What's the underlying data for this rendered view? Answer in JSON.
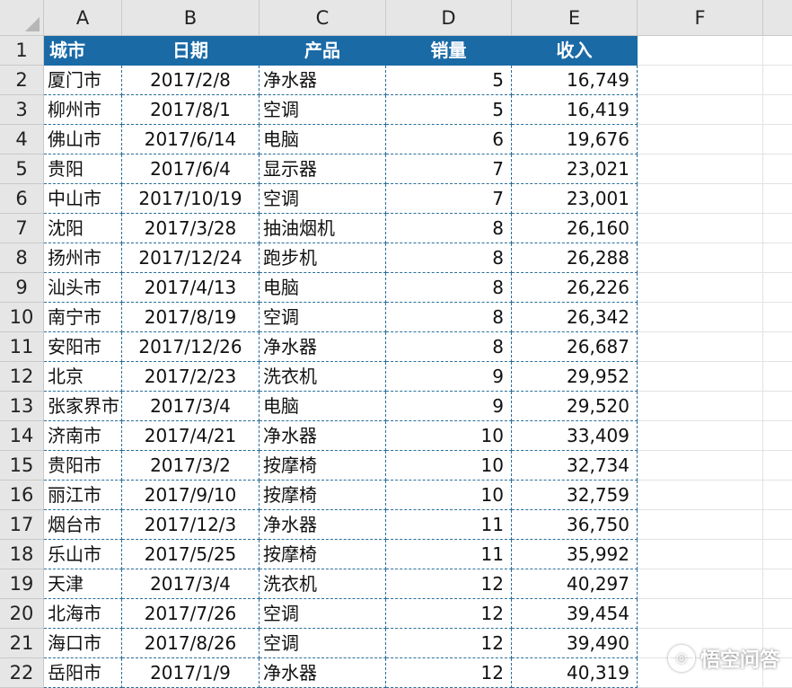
{
  "columns": [
    "A",
    "B",
    "C",
    "D",
    "E",
    "F"
  ],
  "header_row": {
    "row_num": "1",
    "city": "城市",
    "date": "日期",
    "product": "产品",
    "sales": "销量",
    "revenue": "收入"
  },
  "rows": [
    {
      "n": "2",
      "city": "厦门市",
      "date": "2017/2/8",
      "product": "净水器",
      "sales": "5",
      "revenue": "16,749"
    },
    {
      "n": "3",
      "city": "柳州市",
      "date": "2017/8/1",
      "product": "空调",
      "sales": "5",
      "revenue": "16,419"
    },
    {
      "n": "4",
      "city": "佛山市",
      "date": "2017/6/14",
      "product": "电脑",
      "sales": "6",
      "revenue": "19,676"
    },
    {
      "n": "5",
      "city": "贵阳",
      "date": "2017/6/4",
      "product": "显示器",
      "sales": "7",
      "revenue": "23,021"
    },
    {
      "n": "6",
      "city": "中山市",
      "date": "2017/10/19",
      "product": "空调",
      "sales": "7",
      "revenue": "23,001"
    },
    {
      "n": "7",
      "city": "沈阳",
      "date": "2017/3/28",
      "product": "抽油烟机",
      "sales": "8",
      "revenue": "26,160"
    },
    {
      "n": "8",
      "city": "扬州市",
      "date": "2017/12/24",
      "product": "跑步机",
      "sales": "8",
      "revenue": "26,288"
    },
    {
      "n": "9",
      "city": "汕头市",
      "date": "2017/4/13",
      "product": "电脑",
      "sales": "8",
      "revenue": "26,226"
    },
    {
      "n": "10",
      "city": "南宁市",
      "date": "2017/8/19",
      "product": "空调",
      "sales": "8",
      "revenue": "26,342"
    },
    {
      "n": "11",
      "city": "安阳市",
      "date": "2017/12/26",
      "product": "净水器",
      "sales": "8",
      "revenue": "26,687"
    },
    {
      "n": "12",
      "city": "北京",
      "date": "2017/2/23",
      "product": "洗衣机",
      "sales": "9",
      "revenue": "29,952"
    },
    {
      "n": "13",
      "city": "张家界市",
      "date": "2017/3/4",
      "product": "电脑",
      "sales": "9",
      "revenue": "29,520"
    },
    {
      "n": "14",
      "city": "济南市",
      "date": "2017/4/21",
      "product": "净水器",
      "sales": "10",
      "revenue": "33,409"
    },
    {
      "n": "15",
      "city": "贵阳市",
      "date": "2017/3/2",
      "product": "按摩椅",
      "sales": "10",
      "revenue": "32,734"
    },
    {
      "n": "16",
      "city": "丽江市",
      "date": "2017/9/10",
      "product": "按摩椅",
      "sales": "10",
      "revenue": "32,759"
    },
    {
      "n": "17",
      "city": "烟台市",
      "date": "2017/12/3",
      "product": "净水器",
      "sales": "11",
      "revenue": "36,750"
    },
    {
      "n": "18",
      "city": "乐山市",
      "date": "2017/5/25",
      "product": "按摩椅",
      "sales": "11",
      "revenue": "35,992"
    },
    {
      "n": "19",
      "city": "天津",
      "date": "2017/3/4",
      "product": "洗衣机",
      "sales": "12",
      "revenue": "40,297"
    },
    {
      "n": "20",
      "city": "北海市",
      "date": "2017/7/26",
      "product": "空调",
      "sales": "12",
      "revenue": "39,454"
    },
    {
      "n": "21",
      "city": "海口市",
      "date": "2017/8/26",
      "product": "空调",
      "sales": "12",
      "revenue": "39,490"
    },
    {
      "n": "22",
      "city": "岳阳市",
      "date": "2017/1/9",
      "product": "净水器",
      "sales": "12",
      "revenue": "40,319"
    }
  ],
  "watermark": {
    "text": "悟空问答",
    "logo": "wukong-logo-icon"
  },
  "colors": {
    "header_fill": "#1a6aa6",
    "grid_dash": "#2a6f9a",
    "header_gray": "#e6e6e6"
  }
}
